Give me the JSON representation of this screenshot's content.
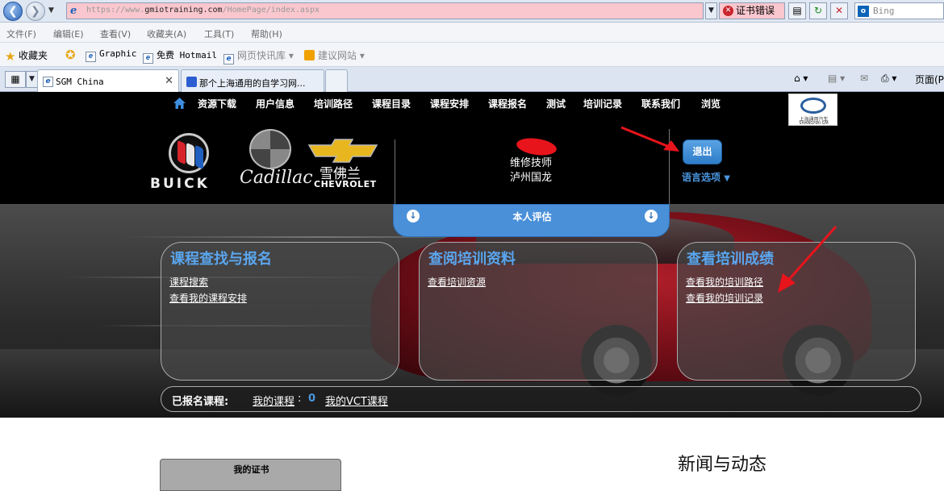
{
  "browser": {
    "url_prefix": "https://www.",
    "url_host": "gmiotraining.com",
    "url_path": "/HomePage/index.aspx",
    "cert_error": "证书错误",
    "search_placeholder": "Bing",
    "menu": [
      "文件(F)",
      "编辑(E)",
      "查看(V)",
      "收藏夹(A)",
      "工具(T)",
      "帮助(H)"
    ],
    "favorites_label": "收藏夹",
    "favorites": [
      "Graphic",
      "免费 Hotmail",
      "网页快讯库",
      "建议网站"
    ],
    "tabs": [
      {
        "label": "SGM China",
        "active": true
      },
      {
        "label": "那个上海通用的自学习网...",
        "active": false
      }
    ],
    "command_page": "页面(P)"
  },
  "site": {
    "nav": [
      "资源下载",
      "用户信息",
      "培训路径",
      "课程目录",
      "课程安排",
      "课程报名",
      "测试",
      "培训记录",
      "联系我们",
      "浏览"
    ],
    "sgm_logo_cn": "上海通用汽车",
    "sgm_logo_en": "SHANGHAI GM",
    "brands": {
      "buick": "BUICK",
      "cadillac": "Cadillac",
      "chevrolet_cn": "雪佛兰",
      "chevrolet_en": "CHEVROLET"
    },
    "user": {
      "role": "维修技师",
      "dealer": "泸州国龙"
    },
    "logout": "退出",
    "language": "语言选项",
    "self_eval": "本人评估",
    "panels": [
      {
        "title": "课程查找与报名",
        "links": [
          "课程搜索",
          "查看我的课程安排"
        ]
      },
      {
        "title": "查阅培训资料",
        "links": [
          "查看培训资源"
        ]
      },
      {
        "title": "查看培训成绩",
        "links": [
          "查看我的培训路径",
          "查看我的培训记录"
        ]
      }
    ],
    "enrolled": {
      "label": "已报名课程:",
      "my_courses": "我的课程",
      "count": "0",
      "vct": "我的VCT课程"
    },
    "certificates": "我的证书",
    "news": "新闻与动态"
  },
  "colors": {
    "accent": "#4a97e0",
    "annotation": "#e8141c",
    "top_bg": "#000000"
  }
}
